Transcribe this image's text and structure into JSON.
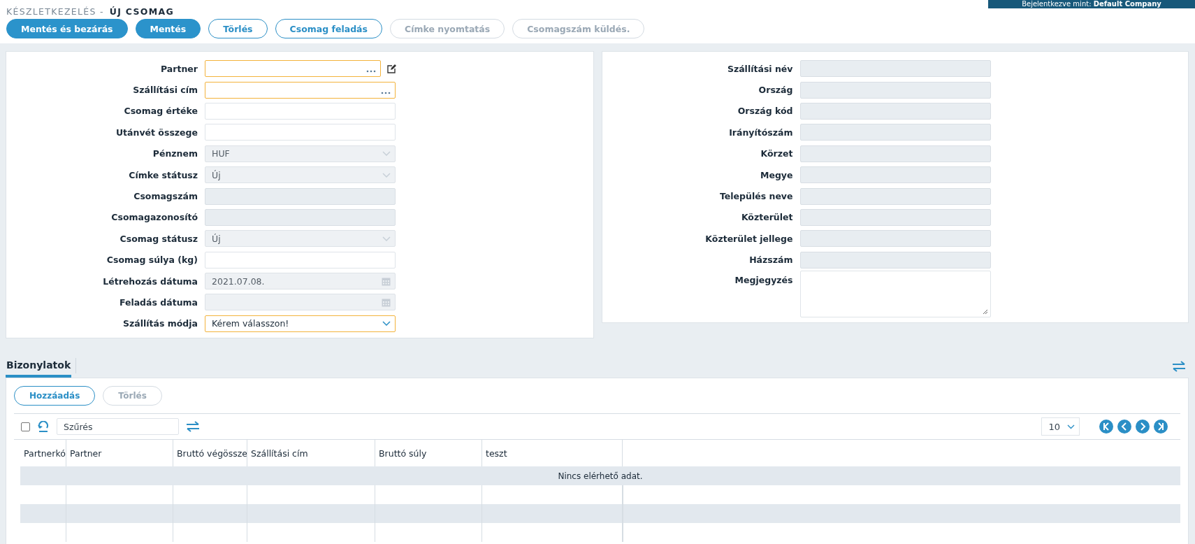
{
  "login_banner": {
    "text": "Bejelentkezve mint: **Default Company**"
  },
  "breadcrumb": {
    "parent": "KÉSZLETKEZELÉS -",
    "current": "ÚJ CSOMAG"
  },
  "toolbar": [
    {
      "label": "Mentés és bezárás",
      "kind": "primary",
      "disabled": false
    },
    {
      "label": "Mentés",
      "kind": "primary",
      "disabled": false
    },
    {
      "label": "Törlés",
      "kind": "outline",
      "disabled": false
    },
    {
      "label": "Csomag feladás",
      "kind": "outline",
      "disabled": false
    },
    {
      "label": "Címke nyomtatás",
      "kind": "outline",
      "disabled": true
    },
    {
      "label": "Csomagszám küldés.",
      "kind": "outline",
      "disabled": true
    }
  ],
  "left_form": [
    {
      "label": "Partner",
      "kind": "lookup",
      "required": true,
      "editable": true
    },
    {
      "label": "Szállítási cím",
      "kind": "lookup",
      "required": true
    },
    {
      "label": "Csomag értéke",
      "kind": "text"
    },
    {
      "label": "Utánvét összege",
      "kind": "text"
    },
    {
      "label": "Pénznem",
      "kind": "select",
      "value": "HUF",
      "disabled": true
    },
    {
      "label": "Címke státusz",
      "kind": "select",
      "value": "Új",
      "disabled": true
    },
    {
      "label": "Csomagszám",
      "kind": "readonly"
    },
    {
      "label": "Csomagazonosító",
      "kind": "readonly"
    },
    {
      "label": "Csomag státusz",
      "kind": "select",
      "value": "Új",
      "disabled": true
    },
    {
      "label": "Csomag súlya (kg)",
      "kind": "text"
    },
    {
      "label": "Létrehozás dátuma",
      "kind": "date",
      "value": "2021.07.08."
    },
    {
      "label": "Feladás dátuma",
      "kind": "date"
    },
    {
      "label": "Szállítás módja",
      "kind": "select",
      "value": "Kérem válasszon!",
      "disabled": false,
      "required": true
    }
  ],
  "right_form": [
    {
      "label": "Szállítási név",
      "kind": "readonly"
    },
    {
      "label": "Ország",
      "kind": "readonly"
    },
    {
      "label": "Ország kód",
      "kind": "readonly"
    },
    {
      "label": "Irányítószám",
      "kind": "readonly"
    },
    {
      "label": "Körzet",
      "kind": "readonly"
    },
    {
      "label": "Megye",
      "kind": "readonly"
    },
    {
      "label": "Település neve",
      "kind": "readonly"
    },
    {
      "label": "Közterület",
      "kind": "readonly"
    },
    {
      "label": "Közterület jellege",
      "kind": "readonly"
    },
    {
      "label": "Házszám",
      "kind": "readonly"
    },
    {
      "label": "Megjegyzés",
      "kind": "textarea"
    }
  ],
  "tabs": [
    {
      "label": "Bizonylatok",
      "selected": true
    }
  ],
  "grid_buttons": [
    {
      "label": "Hozzáadás",
      "disabled": false
    },
    {
      "label": "Törlés",
      "disabled": true
    }
  ],
  "grid_toolbar": {
    "select_all_checked": false,
    "filter_placeholder": "Szűrés",
    "page_size": "10"
  },
  "table": {
    "columns": [
      "Partnerkó",
      "Partner",
      "Bruttó végössze",
      "Szállítási cím",
      "Bruttó súly",
      "teszt"
    ],
    "empty_message": "Nincs elérhető adat."
  }
}
